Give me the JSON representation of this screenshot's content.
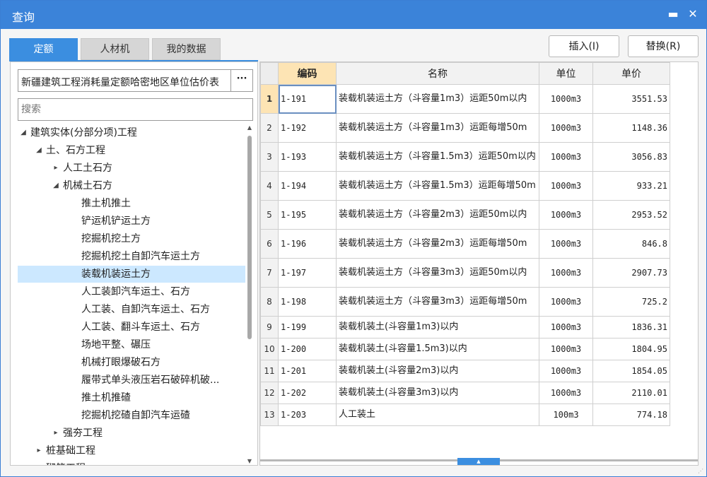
{
  "window": {
    "title": "查询",
    "minimize_glyph": "▬",
    "close_glyph": "✕"
  },
  "tabs": [
    {
      "label": "定额",
      "active": true
    },
    {
      "label": "人材机",
      "active": false
    },
    {
      "label": "我的数据",
      "active": false
    }
  ],
  "actions": {
    "insert_label": "插入(I)",
    "replace_label": "替换(R)"
  },
  "library": {
    "selected": "新疆建筑工程消耗量定额哈密地区单位估价表",
    "browse_glyph": "···"
  },
  "search": {
    "placeholder": "搜索",
    "value": ""
  },
  "tree": [
    {
      "label": "建筑实体(分部分项)工程",
      "level": 0,
      "expander": "expanded"
    },
    {
      "label": "土、石方工程",
      "level": 1,
      "expander": "expanded"
    },
    {
      "label": "人工土石方",
      "level": 2,
      "expander": "collapsed"
    },
    {
      "label": "机械土石方",
      "level": 2,
      "expander": "expanded"
    },
    {
      "label": "推土机推土",
      "level": 3,
      "expander": "none"
    },
    {
      "label": "铲运机铲运土方",
      "level": 3,
      "expander": "none"
    },
    {
      "label": "挖掘机挖土方",
      "level": 3,
      "expander": "none"
    },
    {
      "label": "挖掘机挖土自卸汽车运土方",
      "level": 3,
      "expander": "none"
    },
    {
      "label": "装载机装运土方",
      "level": 3,
      "expander": "none",
      "selected": true
    },
    {
      "label": "人工装卸汽车运土、石方",
      "level": 3,
      "expander": "none"
    },
    {
      "label": "人工装、自卸汽车运土、石方",
      "level": 3,
      "expander": "none"
    },
    {
      "label": "人工装、翻斗车运土、石方",
      "level": 3,
      "expander": "none"
    },
    {
      "label": "场地平整、碾压",
      "level": 3,
      "expander": "none"
    },
    {
      "label": "机械打眼爆破石方",
      "level": 3,
      "expander": "none"
    },
    {
      "label": "履带式单头液压岩石破碎机破...",
      "level": 3,
      "expander": "none"
    },
    {
      "label": "推土机推碴",
      "level": 3,
      "expander": "none"
    },
    {
      "label": "挖掘机挖碴自卸汽车运碴",
      "level": 3,
      "expander": "none"
    },
    {
      "label": "强夯工程",
      "level": 2,
      "expander": "collapsed"
    },
    {
      "label": "桩基础工程",
      "level": 1,
      "expander": "collapsed"
    },
    {
      "label": "砌筑工程",
      "level": 1,
      "expander": "collapsed"
    }
  ],
  "table": {
    "columns": [
      "编码",
      "名称",
      "单位",
      "单价"
    ],
    "rows": [
      {
        "no": "1",
        "code": "1-191",
        "name": "装载机装运土方（斗容量1m3）运距50m以内",
        "unit": "1000m3",
        "price": "3551.53"
      },
      {
        "no": "2",
        "code": "1-192",
        "name": "装载机装运土方（斗容量1m3）运距每增50m",
        "unit": "1000m3",
        "price": "1148.36"
      },
      {
        "no": "3",
        "code": "1-193",
        "name": "装载机装运土方（斗容量1.5m3）运距50m以内",
        "unit": "1000m3",
        "price": "3056.83"
      },
      {
        "no": "4",
        "code": "1-194",
        "name": "装载机装运土方（斗容量1.5m3）运距每增50m",
        "unit": "1000m3",
        "price": "933.21"
      },
      {
        "no": "5",
        "code": "1-195",
        "name": "装载机装运土方（斗容量2m3）运距50m以内",
        "unit": "1000m3",
        "price": "2953.52"
      },
      {
        "no": "6",
        "code": "1-196",
        "name": "装载机装运土方（斗容量2m3）运距每增50m",
        "unit": "1000m3",
        "price": "846.8"
      },
      {
        "no": "7",
        "code": "1-197",
        "name": "装载机装运土方（斗容量3m3）运距50m以内",
        "unit": "1000m3",
        "price": "2907.73"
      },
      {
        "no": "8",
        "code": "1-198",
        "name": "装载机装运土方（斗容量3m3）运距每增50m",
        "unit": "1000m3",
        "price": "725.2"
      },
      {
        "no": "9",
        "code": "1-199",
        "name": "装载机装土(斗容量1m3)以内",
        "unit": "1000m3",
        "price": "1836.31"
      },
      {
        "no": "10",
        "code": "1-200",
        "name": "装载机装土(斗容量1.5m3)以内",
        "unit": "1000m3",
        "price": "1804.95"
      },
      {
        "no": "11",
        "code": "1-201",
        "name": "装载机装土(斗容量2m3)以内",
        "unit": "1000m3",
        "price": "1854.05"
      },
      {
        "no": "12",
        "code": "1-202",
        "name": "装载机装土(斗容量3m3)以内",
        "unit": "1000m3",
        "price": "2110.01"
      },
      {
        "no": "13",
        "code": "1-203",
        "name": "人工装土",
        "unit": "100m3",
        "price": "774.18"
      }
    ],
    "current_row": 0
  },
  "icons": {
    "expanded": "◢",
    "collapsed": "▸",
    "scroll_up": "▲",
    "scroll_down": "▼",
    "splitter": "▲",
    "resize": "⋰"
  }
}
